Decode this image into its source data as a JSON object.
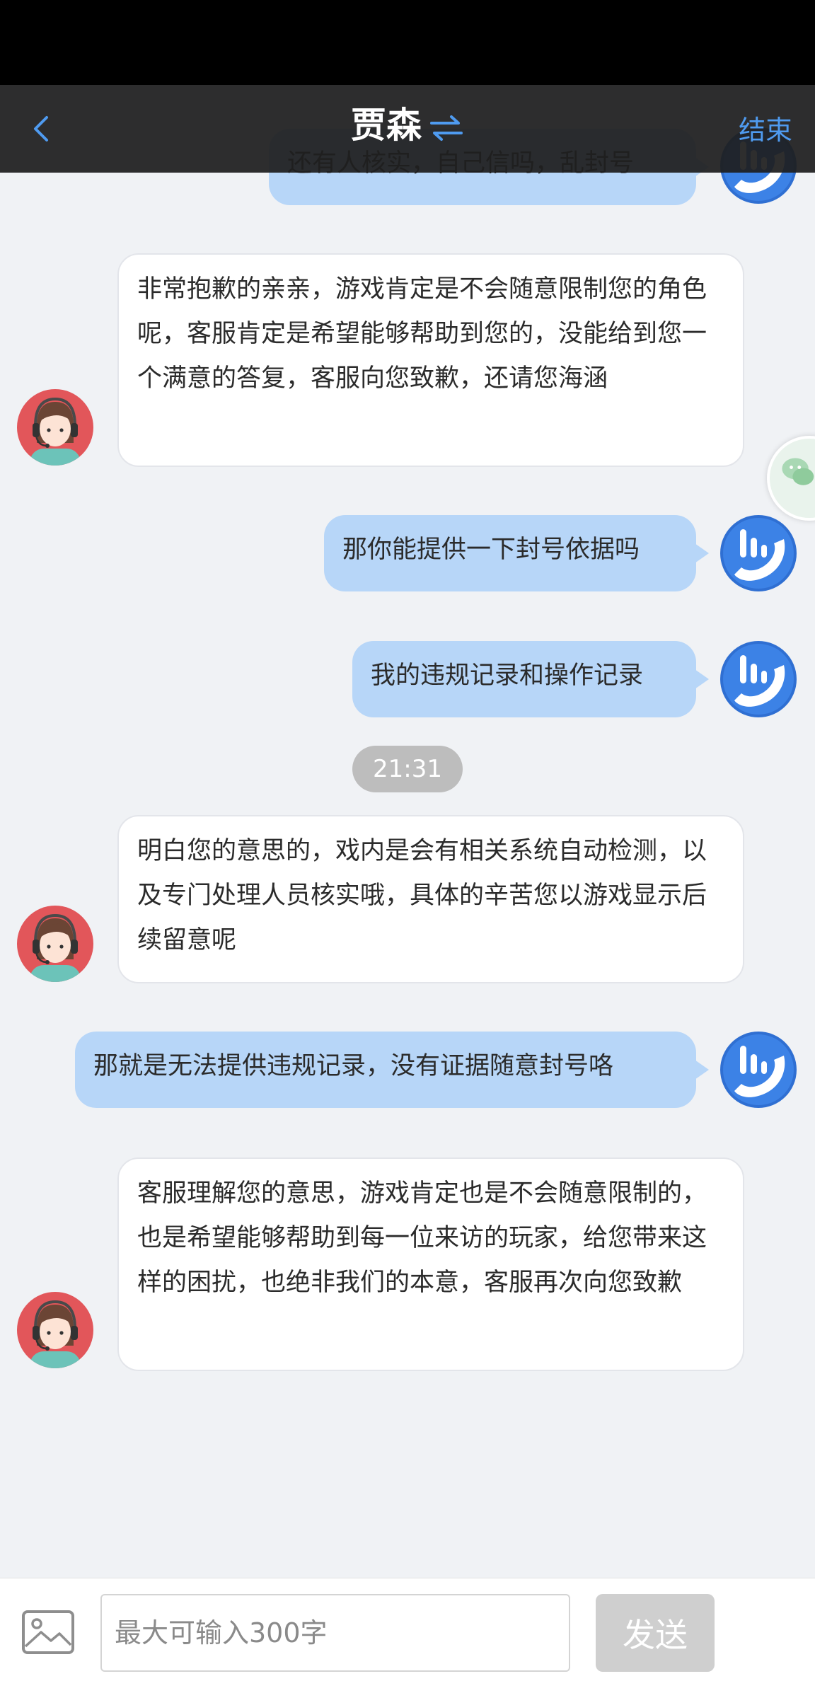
{
  "header": {
    "title": "贾森",
    "end_label": "结束",
    "back_icon": "chevron-left-icon",
    "switch_icon": "swap-arrows-icon"
  },
  "messages": [
    {
      "sender": "user",
      "text": "还有人核实，自己信吗，乱封号"
    },
    {
      "sender": "agent",
      "text": "非常抱歉的亲亲，游戏肯定是不会随意限制您的角色呢，客服肯定是希望能够帮助到您的，没能给到您一个满意的答复，客服向您致歉，还请您海涵"
    },
    {
      "sender": "user",
      "text": "那你能提供一下封号依据吗"
    },
    {
      "sender": "user",
      "text": "我的违规记录和操作记录"
    },
    {
      "sender": "timestamp",
      "text": "21:31"
    },
    {
      "sender": "agent",
      "text": "明白您的意思的，戏内是会有相关系统自动检测，以及专门处理人员核实哦，具体的辛苦您以游戏显示后续留意呢"
    },
    {
      "sender": "user",
      "text": "那就是无法提供违规记录，没有证据随意封号咯"
    },
    {
      "sender": "agent",
      "text": "客服理解您的意思，游戏肯定也是不会随意限制的，也是希望能够帮助到每一位来访的玩家，给您带来这样的困扰，也绝非我们的本意，客服再次向您致歉"
    }
  ],
  "input": {
    "placeholder": "最大可输入300字",
    "value": "",
    "send_label": "发送",
    "image_icon": "image-icon"
  },
  "colors": {
    "accent": "#4f9bf0",
    "user_bubble": "#b7d6f8",
    "agent_bubble": "#ffffff",
    "background": "#f0f2f5",
    "header": "#1e1e1e"
  }
}
